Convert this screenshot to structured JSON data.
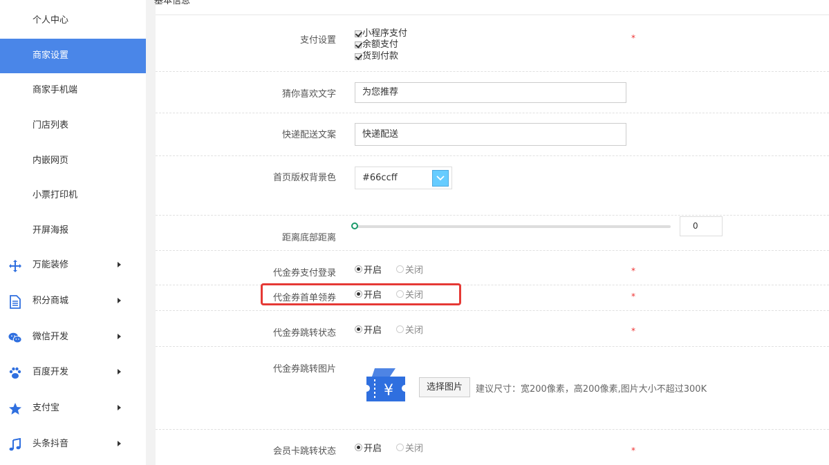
{
  "sidebar": {
    "items": [
      {
        "label": "个人中心"
      },
      {
        "label": "商家设置"
      },
      {
        "label": "商家手机端"
      },
      {
        "label": "门店列表"
      },
      {
        "label": "内嵌网页"
      },
      {
        "label": "小票打印机"
      },
      {
        "label": "开屏海报"
      },
      {
        "label": "万能装修",
        "icon": "move-icon"
      },
      {
        "label": "积分商城",
        "icon": "document-icon"
      },
      {
        "label": "微信开发",
        "icon": "wechat-icon"
      },
      {
        "label": "百度开发",
        "icon": "paw-icon"
      },
      {
        "label": "支付宝",
        "icon": "star-icon"
      },
      {
        "label": "头条抖音",
        "icon": "music-icon"
      }
    ],
    "active_color": "#4a86e8"
  },
  "header": {
    "title": "基本信息"
  },
  "form": {
    "payment": {
      "label": "支付设置",
      "options": [
        "小程序支付",
        "余额支付",
        "货到付款"
      ],
      "star": "*"
    },
    "guess_text": {
      "label": "猜你喜欢文字",
      "value": "为您推荐"
    },
    "express_text": {
      "label": "快递配送文案",
      "value": "快递配送"
    },
    "copyright_bg": {
      "label": "首页版权背景色",
      "value": "#66ccff"
    },
    "bottom_distance": {
      "label": "距离底部距离",
      "value": "0"
    },
    "coupon_pay_login": {
      "label": "代金券支付登录",
      "on": "开启",
      "off": "关闭",
      "star": "*"
    },
    "coupon_first_order": {
      "label": "代金券首单领券",
      "on": "开启",
      "off": "关闭",
      "star": "*"
    },
    "coupon_jump_status": {
      "label": "代金券跳转状态",
      "on": "开启",
      "off": "关闭",
      "star": "*"
    },
    "coupon_jump_image": {
      "label": "代金券跳转图片",
      "button": "选择图片",
      "hint": "建议尺寸：宽200像素，高200像素,图片大小不超过300K",
      "coupon_glyph": "¥"
    },
    "member_jump_status": {
      "label": "会员卡跳转状态",
      "on": "开启",
      "off": "关闭",
      "star": "*"
    }
  },
  "colors": {
    "highlight": "#e53935",
    "picker": "#66ccff",
    "coupon": "#2f6fdf"
  }
}
